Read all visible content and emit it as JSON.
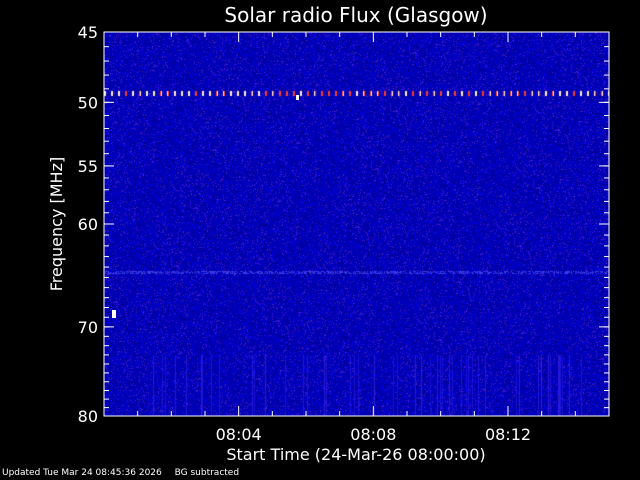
{
  "chart_data": {
    "type": "heatmap",
    "title": "Solar radio Flux (Glasgow)",
    "xlabel": "Start Time (24-Mar-26 08:00:00)",
    "ylabel": "Frequency [MHz]",
    "x_range_minutes": [
      0,
      15
    ],
    "ylim": [
      45,
      80
    ],
    "y_ticks": [
      {
        "value": 45,
        "label": "45"
      },
      {
        "value": 50,
        "label": "50"
      },
      {
        "value": 55,
        "label": "55"
      },
      {
        "value": 60,
        "label": "60"
      },
      {
        "value": 70,
        "label": "70"
      },
      {
        "value": 80,
        "label": "80"
      }
    ],
    "x_ticks": [
      {
        "value": 4,
        "label": "08:04"
      },
      {
        "value": 8,
        "label": "08:08"
      },
      {
        "value": 12,
        "label": "08:12"
      }
    ],
    "colors": {
      "background": "#000000",
      "spectrum_base": "#1a1ab0",
      "hot": "#ffffff",
      "warm": "#ff4020"
    },
    "features": [
      {
        "description_tag": "interference-line",
        "freq_mhz": 49.3
      },
      {
        "description_tag": "interference-band",
        "freq_mhz": 64.5
      },
      {
        "description_tag": "noisy-band",
        "freq_mhz_range": [
          73,
          80
        ]
      }
    ]
  },
  "footer": {
    "updated": "Updated Tue Mar 24 08:45:36 2026",
    "note": "BG subtracted"
  }
}
